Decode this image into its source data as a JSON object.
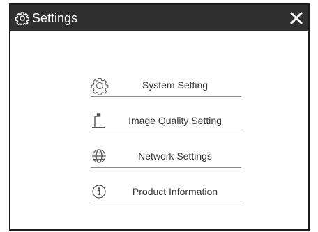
{
  "window": {
    "title": "Settings",
    "title_icon": "gear-icon",
    "close_icon": "close-icon"
  },
  "menu": {
    "items": [
      {
        "label": "System Setting",
        "icon": "gear-icon"
      },
      {
        "label": "Image Quality Setting",
        "icon": "document-camera-icon"
      },
      {
        "label": "Network Settings",
        "icon": "globe-icon"
      },
      {
        "label": "Product Information",
        "icon": "info-icon"
      }
    ]
  },
  "colors": {
    "titlebar_bg": "#2f2f2f",
    "title_text": "#ffffff",
    "item_text": "#333333",
    "divider": "#8a8a8a"
  }
}
